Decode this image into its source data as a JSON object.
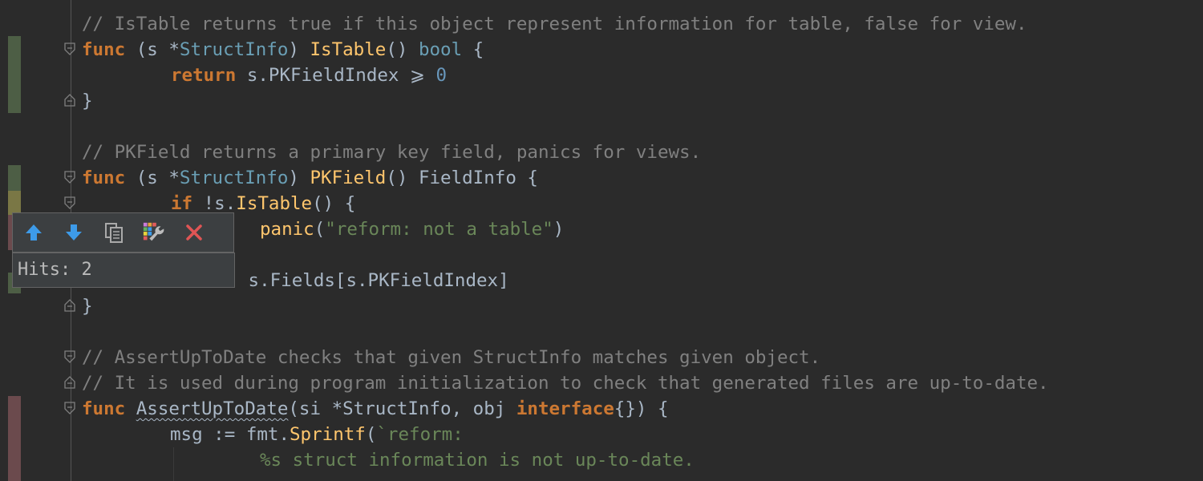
{
  "editor": {
    "lines": {
      "l1": {
        "comment": "// IsTable returns true if this object represent information for table, false for view."
      },
      "l2": {
        "kw": "func",
        "a": " (s *",
        "type": "StructInfo",
        "b": ") ",
        "fn": "IsTable",
        "c": "() ",
        "ret": "bool",
        "d": " {"
      },
      "l3": {
        "kw": "return",
        "a": " s.PKFieldIndex ",
        "op": "⩾",
        "b": " ",
        "num": "0"
      },
      "l4": {
        "text": "}"
      },
      "l6": {
        "comment": "// PKField returns a primary key field, panics for views."
      },
      "l7": {
        "kw": "func",
        "a": " (s *",
        "type": "StructInfo",
        "b": ") ",
        "fn": "PKField",
        "c": "() FieldInfo {"
      },
      "l8": {
        "kw": "if",
        "a": " !s.",
        "fn": "IsTable",
        "b": "() {"
      },
      "l9": {
        "fn": "panic",
        "a": "(",
        "str": "\"reform: not a table\"",
        "b": ")"
      },
      "l11": {
        "text": " s.Fields[s.PKFieldIndex]"
      },
      "l12": {
        "text": "}"
      },
      "l14": {
        "comment": "// AssertUpToDate checks that given StructInfo matches given object."
      },
      "l15": {
        "comment": "// It is used during program initialization to check that generated files are up-to-date."
      },
      "l16": {
        "kw": "func",
        "fn": "AssertUpToDate",
        "a": "(si *StructInfo, obj ",
        "kw2": "interface",
        "b": "{}) {"
      },
      "l17": {
        "a": "msg := fmt.",
        "fn": "Sprintf",
        "b": "(",
        "str": "`reform:"
      },
      "l18": {
        "str": "%s struct information is not up-to-date."
      }
    }
  },
  "search_popup": {
    "prev_icon": "arrow-up-icon",
    "next_icon": "arrow-down-icon",
    "copy_icon": "copy-icon",
    "settings_icon": "settings-wrench-icon",
    "close_icon": "close-icon",
    "hits_label": "Hits: 2"
  },
  "colors": {
    "background": "#2b2b2b",
    "keyword": "#cc7832",
    "function": "#ffc66d",
    "comment": "#808080",
    "string": "#6a8759",
    "number": "#6897bb",
    "change_added": "#4d5e45",
    "change_modified": "#7a7745",
    "change_deleted": "#6b4a4d"
  }
}
